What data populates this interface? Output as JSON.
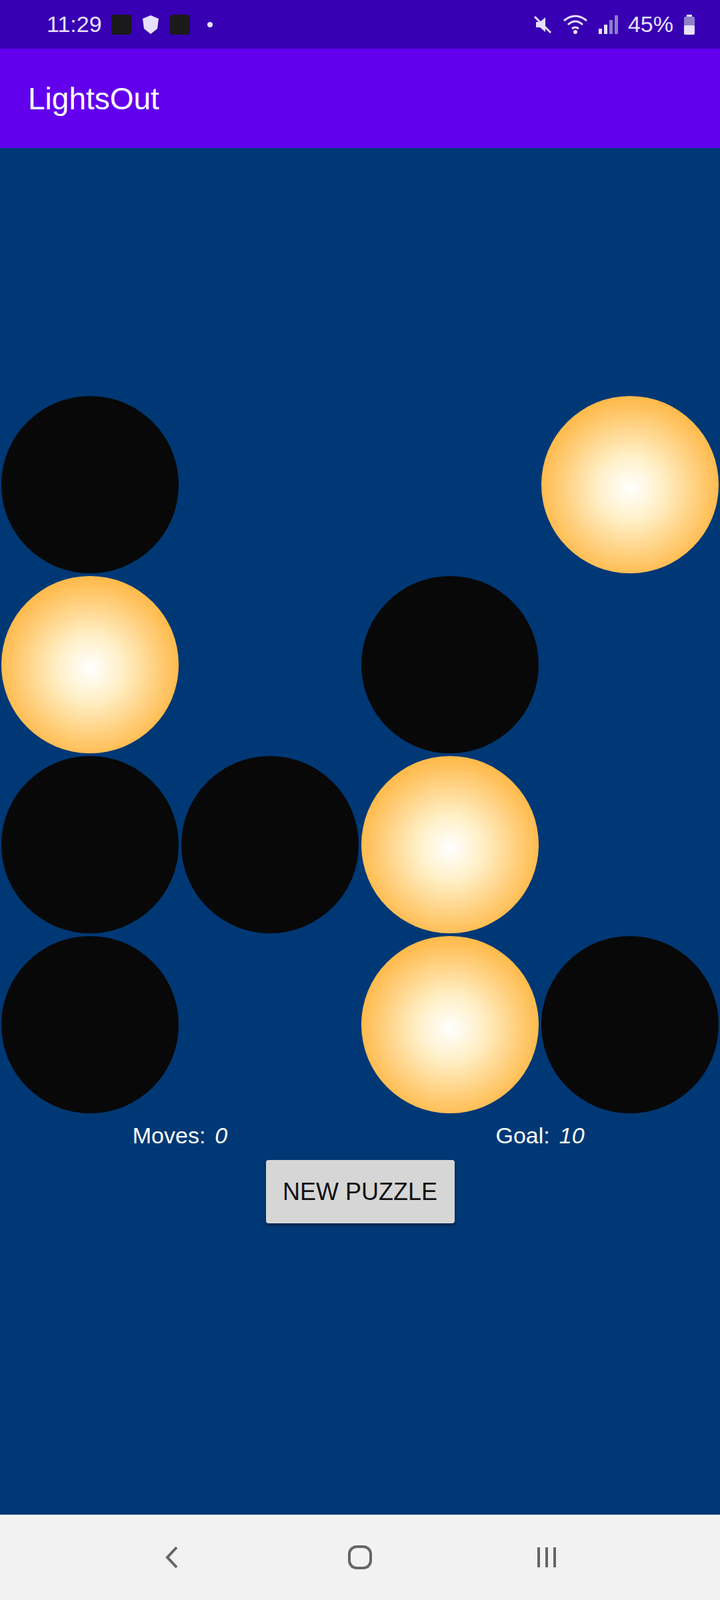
{
  "status_bar": {
    "time": "11:29",
    "battery": "45%"
  },
  "app_bar": {
    "title": "LightsOut"
  },
  "board": {
    "rows": [
      [
        {
          "kind": "dark"
        },
        {
          "kind": "empty"
        },
        {
          "kind": "empty"
        },
        {
          "kind": "lit"
        }
      ],
      [
        {
          "kind": "lit"
        },
        {
          "kind": "empty"
        },
        {
          "kind": "dark"
        },
        {
          "kind": "empty"
        }
      ],
      [
        {
          "kind": "dark"
        },
        {
          "kind": "dark"
        },
        {
          "kind": "lit"
        },
        {
          "kind": "empty"
        }
      ],
      [
        {
          "kind": "dark"
        },
        {
          "kind": "empty"
        },
        {
          "kind": "lit"
        },
        {
          "kind": "dark"
        }
      ]
    ]
  },
  "moves": {
    "label": "Moves:",
    "value": "0"
  },
  "goal": {
    "label": "Goal:",
    "value": "10"
  },
  "buttons": [
    "NEW PUZZLE"
  ]
}
